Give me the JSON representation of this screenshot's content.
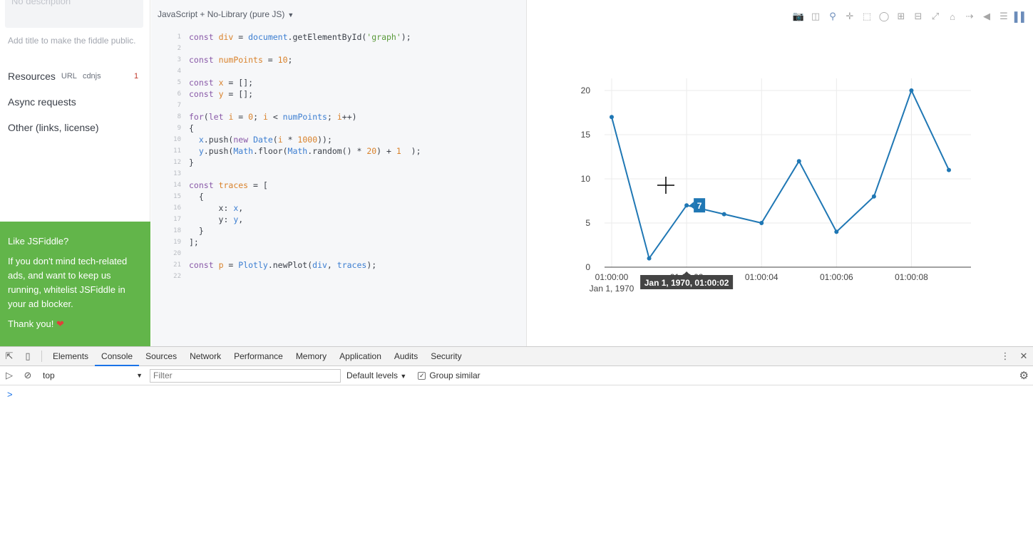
{
  "sidebar": {
    "description_placeholder": "No description",
    "public_hint": "Add title to make the fiddle public.",
    "resources": {
      "label": "Resources",
      "url": "URL",
      "cdnjs": "cdnjs",
      "count": "1"
    },
    "async_label": "Async requests",
    "other_label": "Other (links, license)",
    "promo": {
      "heading": "Like JSFiddle?",
      "body": "If you don't mind tech-related ads, and want to keep us running, whitelist JSFiddle in your ad blocker.",
      "thanks": "Thank you!"
    }
  },
  "editor": {
    "language_label": "JavaScript + No-Library (pure JS)",
    "line_numbers": [
      "1",
      "2",
      "3",
      "4",
      "5",
      "6",
      "7",
      "8",
      "9",
      "10",
      "11",
      "12",
      "13",
      "14",
      "15",
      "16",
      "17",
      "18",
      "19",
      "20",
      "21",
      "22"
    ]
  },
  "plot": {
    "tooltip_y": "7",
    "tooltip_x": "Jan 1, 1970, 01:00:02",
    "modebar_icons": [
      "camera-icon",
      "save-icon",
      "zoom-icon",
      "pan-icon",
      "box-select-icon",
      "lasso-icon",
      "zoom-in-icon",
      "zoom-out-icon",
      "autoscale-icon",
      "reset-axes-icon",
      "spike-lines-icon",
      "hover-closest-icon",
      "hover-compare-icon",
      "plotly-logo-icon"
    ]
  },
  "chart_data": {
    "type": "line",
    "x": [
      "01:00:00",
      "01:00:01",
      "01:00:02",
      "01:00:03",
      "01:00:04",
      "01:00:05",
      "01:00:06",
      "01:00:07",
      "01:00:08",
      "01:00:09"
    ],
    "values": [
      17,
      1,
      7,
      6,
      5,
      12,
      4,
      8,
      20,
      11
    ],
    "x_tick_labels": [
      "01:00:00",
      "01:00:02",
      "01:00:04",
      "01:00:06",
      "01:00:08"
    ],
    "x_tick_sublabel": "Jan 1, 1970",
    "y_tick_labels": [
      "0",
      "5",
      "10",
      "15",
      "20"
    ],
    "ylim": [
      0,
      21
    ],
    "grid": true,
    "color": "#1f77b4"
  },
  "devtools": {
    "tabs": [
      "Elements",
      "Console",
      "Sources",
      "Network",
      "Performance",
      "Memory",
      "Application",
      "Audits",
      "Security"
    ],
    "active_tab": "Console",
    "context": "top",
    "filter_placeholder": "Filter",
    "levels": "Default levels",
    "group_similar": "Group similar",
    "prompt": ">"
  }
}
